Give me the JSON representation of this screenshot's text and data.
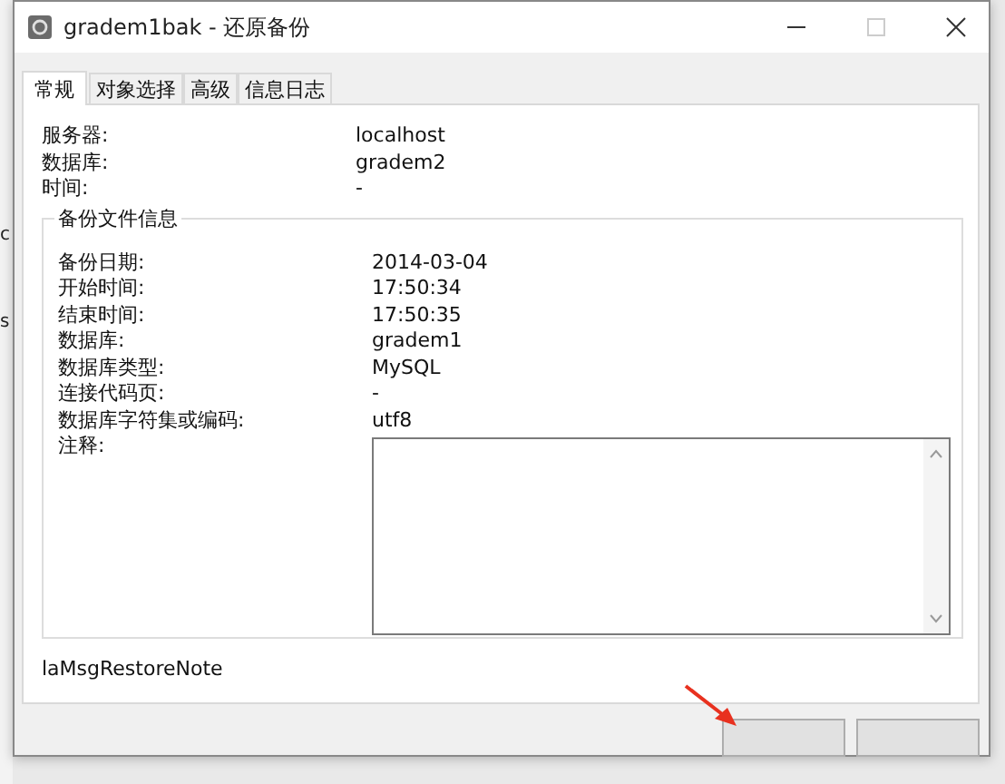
{
  "background_window": {
    "texts": [
      "c",
      "s"
    ]
  },
  "window": {
    "title": "gradem1bak - 还原备份"
  },
  "tabs": [
    {
      "label": "常规",
      "selected": true
    },
    {
      "label": "对象选择",
      "selected": false
    },
    {
      "label": "高级",
      "selected": false
    },
    {
      "label": "信息日志",
      "selected": false
    }
  ],
  "server_info": [
    {
      "label": "服务器:",
      "value": "localhost"
    },
    {
      "label": "数据库:",
      "value": "gradem2"
    },
    {
      "label": "时间:",
      "value": "-"
    }
  ],
  "backup_file_info": {
    "title": "备份文件信息",
    "fields": [
      {
        "label": "备份日期:",
        "value": "2014-03-04"
      },
      {
        "label": "开始时间:",
        "value": "17:50:34"
      },
      {
        "label": "结束时间:",
        "value": "17:50:35"
      },
      {
        "label": "数据库:",
        "value": "gradem1"
      },
      {
        "label": "数据库类型:",
        "value": "MySQL"
      },
      {
        "label": "连接代码页:",
        "value": "-"
      },
      {
        "label": "数据库字符集或编码:",
        "value": "utf8"
      }
    ],
    "notes_label": "注释:"
  },
  "note": "laMsgRestoreNote",
  "buttons": [
    {
      "kind": "blank"
    },
    {
      "kind": "blank"
    }
  ]
}
